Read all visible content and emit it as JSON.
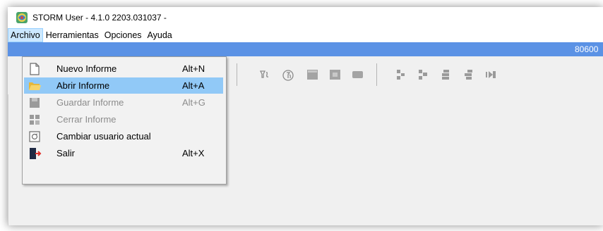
{
  "window": {
    "title": "STORM User - 4.1.0  2203.031037 -"
  },
  "menubar": {
    "items": [
      {
        "label": "Archivo"
      },
      {
        "label": "Herramientas"
      },
      {
        "label": "Opciones"
      },
      {
        "label": "Ayuda"
      }
    ]
  },
  "bluebar": {
    "text": "80600"
  },
  "archivo_menu": {
    "items": [
      {
        "label": "Nuevo Informe",
        "shortcut": "Alt+N",
        "icon": "new-document-icon",
        "enabled": true
      },
      {
        "label": "Abrir Informe",
        "shortcut": "Alt+A",
        "icon": "open-folder-icon",
        "enabled": true,
        "highlighted": true
      },
      {
        "label": "Guardar Informe",
        "shortcut": "Alt+G",
        "icon": "save-icon",
        "enabled": false
      },
      {
        "label": "Cerrar Informe",
        "shortcut": "",
        "icon": "close-report-icon",
        "enabled": false
      },
      {
        "label": "Cambiar usuario actual",
        "shortcut": "",
        "icon": "change-user-icon",
        "enabled": true
      },
      {
        "label": "Salir",
        "shortcut": "Alt+X",
        "icon": "exit-icon",
        "enabled": true
      }
    ]
  },
  "toolbar": {
    "icons": [
      "arrow-right-icon",
      "filter-icon",
      "filter-function-icon",
      "grid-icon",
      "table-icon",
      "card-icon",
      "tree-icon",
      "tree-expand-icon",
      "stack-icon",
      "stack-expand-icon",
      "next-icon"
    ]
  },
  "colors": {
    "accent_bar": "#5b92e5",
    "menu_highlight": "#91c9f7"
  }
}
